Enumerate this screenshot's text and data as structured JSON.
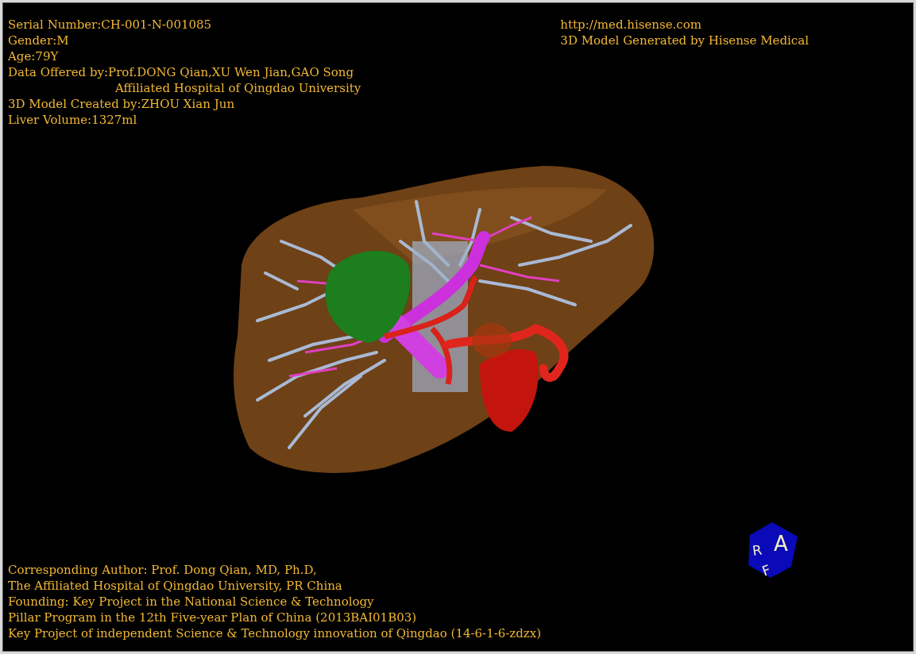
{
  "patient_info": [
    {
      "text": "Serial Number:CH-001-N-001085",
      "kind": "line"
    },
    {
      "text": "Gender:M",
      "kind": "line"
    },
    {
      "text": "Age:79Y",
      "kind": "line"
    },
    {
      "text": "Data Offered by:Prof.DONG Qian,XU Wen Jian,GAO Song",
      "kind": "line"
    },
    {
      "text": "Affiliated Hospital of Qingdao University",
      "kind": "indent"
    },
    {
      "text": "3D Model Created by:ZHOU Xian Jun",
      "kind": "line"
    },
    {
      "text": "Liver Volume:1327ml",
      "kind": "line"
    }
  ],
  "publisher_info": [
    "http://med.hisense.com",
    "3D Model Generated by Hisense Medical"
  ],
  "credits": [
    "Corresponding Author: Prof. Dong Qian, MD, Ph.D,",
    "The Affiliated Hospital of Qingdao University, PR China",
    "Founding: Key Project in the National Science & Technology",
    "Pillar Program in the 12th Five-year Plan of China (2013BAI01B03)",
    "Key Project of independent Science & Technology innovation of Qingdao (14-6-1-6-zdzx)"
  ],
  "orientation_cube": {
    "labels": [
      {
        "text": "R",
        "kind": "left"
      },
      {
        "text": "A",
        "kind": "front"
      },
      {
        "text": "F",
        "kind": "bottom"
      }
    ]
  }
}
